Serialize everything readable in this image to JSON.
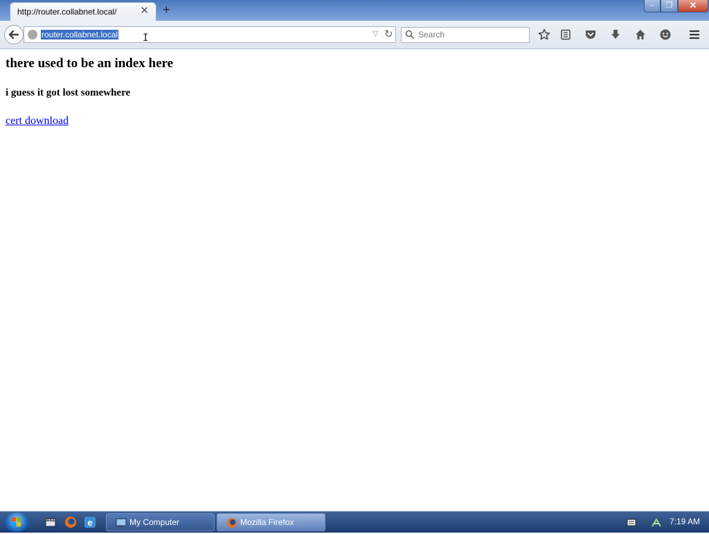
{
  "window": {
    "tab_title": "http://router.collabnet.local/",
    "close_tab": "✕",
    "new_tab": "+",
    "minimize": "–",
    "maximize": "❐",
    "close": "✕"
  },
  "toolbar": {
    "url": "router.collabnet.local",
    "search_placeholder": "Search"
  },
  "page": {
    "heading1": "there used to be an index here",
    "heading2": "i guess it got lost somewhere",
    "link": "cert download"
  },
  "taskbar": {
    "items": [
      {
        "label": "My Computer"
      },
      {
        "label": "Mozilla Firefox"
      }
    ],
    "clock": "7:19 AM"
  },
  "colors": {
    "link": "#0000ee",
    "url_selection": "#3a6fc4",
    "titlebar": "#4a78bd",
    "taskbar": "#1c3c6e"
  }
}
